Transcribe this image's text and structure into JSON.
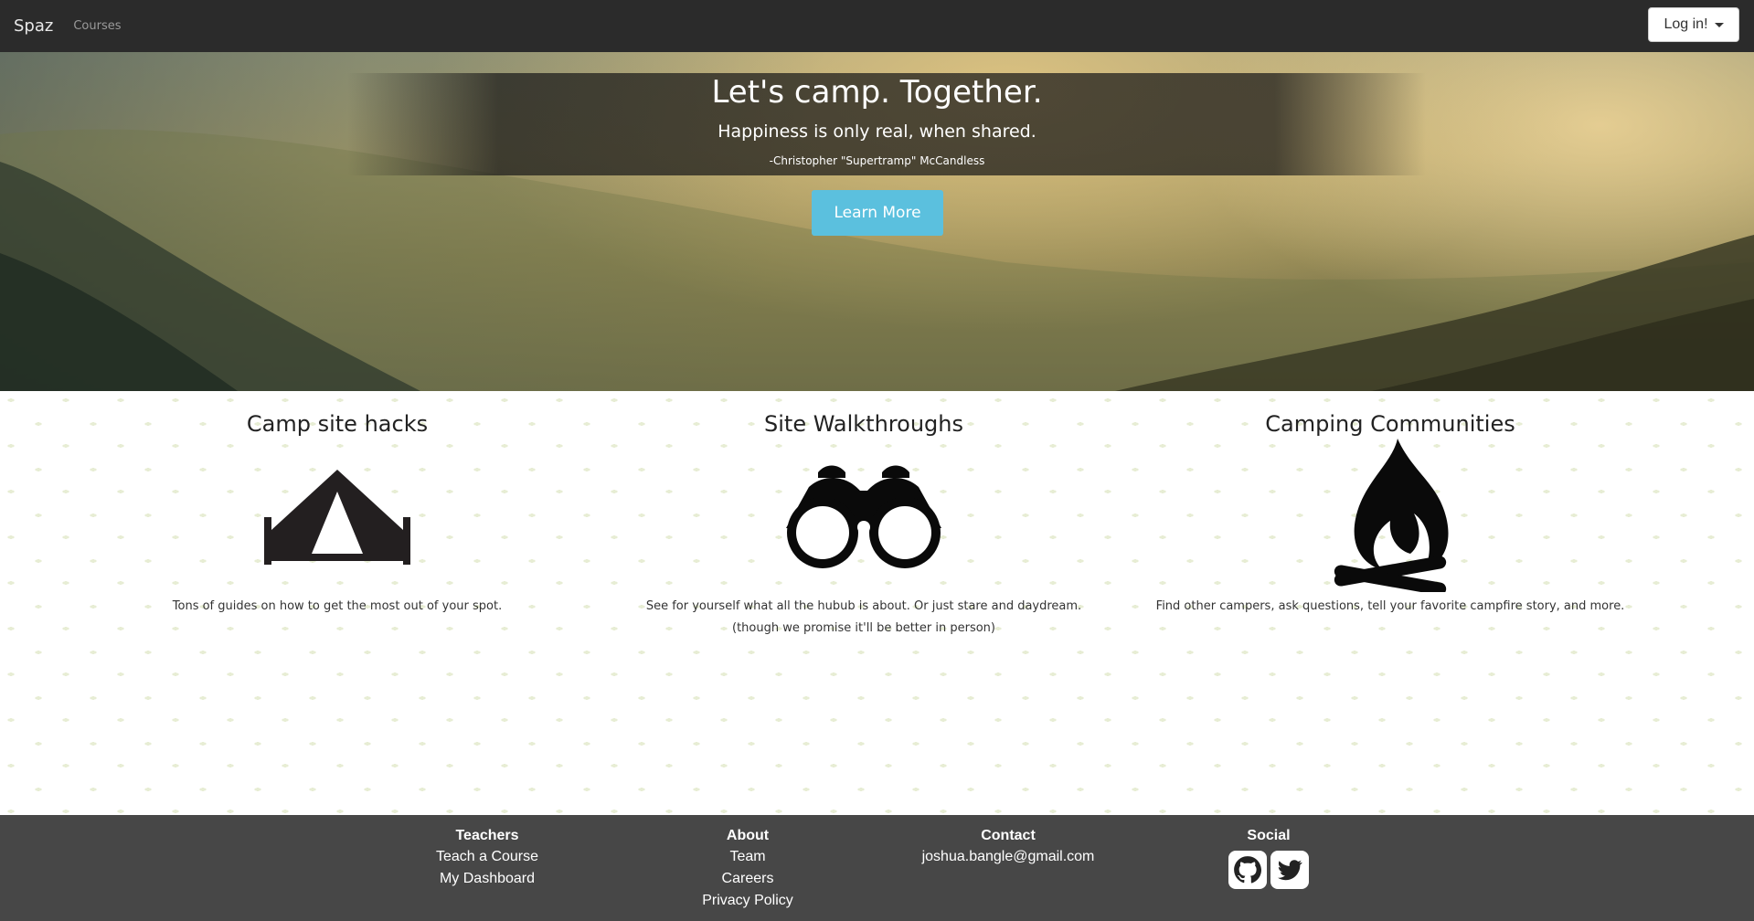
{
  "navbar": {
    "brand": "Spaz",
    "courses_link": "Courses",
    "login_label": "Log in!"
  },
  "hero": {
    "title": "Let's camp. Together.",
    "subtitle": "Happiness is only real, when shared.",
    "quote_author": "-Christopher \"Supertramp\" McCandless",
    "cta_label": "Learn More"
  },
  "features": [
    {
      "title": "Camp site hacks",
      "icon": "tent-icon",
      "description": "Tons of guides on how to get the most out of your spot."
    },
    {
      "title": "Site Walkthroughs",
      "icon": "binoculars-icon",
      "description": "See for yourself what all the hubub is about. Or just stare and daydream. (though we promise it'll be better in person)"
    },
    {
      "title": "Camping Communities",
      "icon": "campfire-icon",
      "description": "Find other campers, ask questions, tell your favorite campfire story, and more."
    }
  ],
  "footer": {
    "teachers": {
      "heading": "Teachers",
      "links": [
        "Teach a Course",
        "My Dashboard"
      ]
    },
    "about": {
      "heading": "About",
      "links": [
        "Team",
        "Careers",
        "Privacy Policy"
      ]
    },
    "contact": {
      "heading": "Contact",
      "email": "joshua.bangle@gmail.com"
    },
    "social": {
      "heading": "Social",
      "icons": [
        "github-icon",
        "twitter-icon"
      ]
    }
  },
  "colors": {
    "navbar": "#2b2b2b",
    "cta": "#5bc0de",
    "footer": "#474747"
  }
}
